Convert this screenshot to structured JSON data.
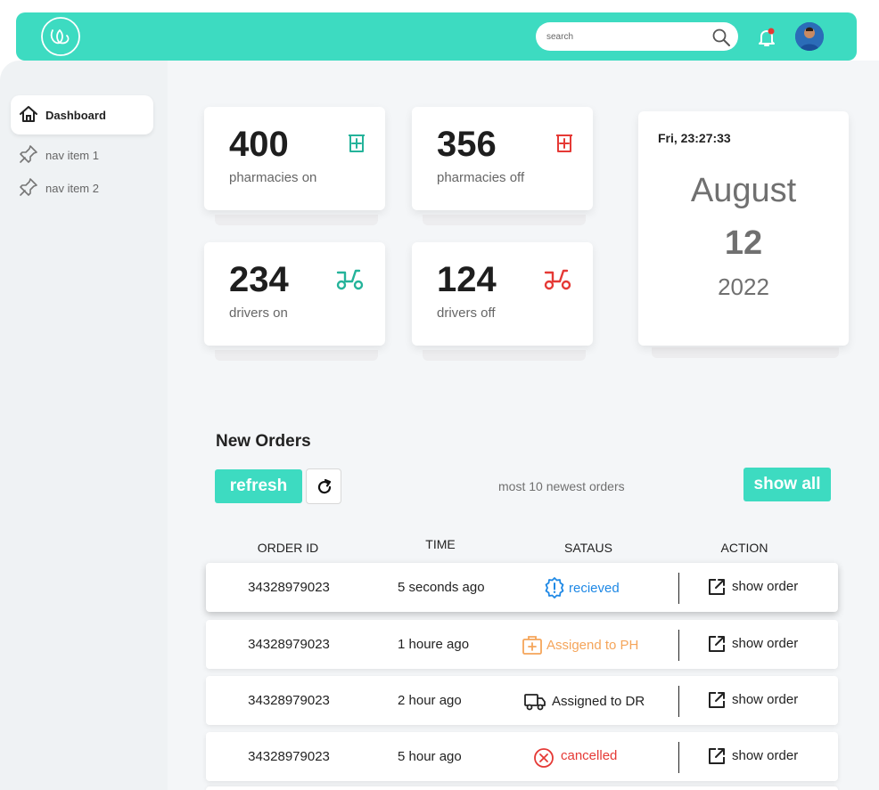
{
  "header": {
    "search_placeholder": "search",
    "icons": [
      "logo-icon",
      "search-icon",
      "bell-icon",
      "avatar"
    ],
    "colors": {
      "brand": "#3ddbc1",
      "alert_dot": "#e53935"
    }
  },
  "sidebar": {
    "items": [
      {
        "label": "Dashboard",
        "icon": "home-icon",
        "active": true
      },
      {
        "label": "nav item 1",
        "icon": "pin-icon",
        "active": false
      },
      {
        "label": "nav item 2",
        "icon": "pin-icon",
        "active": false
      }
    ]
  },
  "stats": [
    {
      "value": "400",
      "label": "pharmacies on",
      "icon": "pharmacy-icon",
      "color": "#24b39a"
    },
    {
      "value": "356",
      "label": "pharmacies  off",
      "icon": "pharmacy-icon",
      "color": "#e53935"
    },
    {
      "value": "234",
      "label": "drivers on",
      "icon": "scooter-icon",
      "color": "#24b39a"
    },
    {
      "value": "124",
      "label": "drivers off",
      "icon": "scooter-icon",
      "color": "#e53935"
    }
  ],
  "date_card": {
    "clock": "Fri, 23:27:33",
    "month": "August",
    "day": "12",
    "year": "2022"
  },
  "orders": {
    "title": "New Orders",
    "refresh_label": "refresh",
    "caption": "most 10 newest orders",
    "show_all_label": "show all",
    "columns": [
      "ORDER ID",
      "TIME",
      "SATAUS",
      "ACTION"
    ],
    "rows": [
      {
        "id": "34328979023",
        "time": "5 seconds ago",
        "status": "recieved",
        "status_icon": "alert-badge-icon",
        "status_color": "#1e88e5",
        "action": "show order"
      },
      {
        "id": "34328979023",
        "time": "1 houre ago",
        "status": "Assigend to PH",
        "status_icon": "medical-kit-icon",
        "status_color": "#f5a55a",
        "action": "show order"
      },
      {
        "id": "34328979023",
        "time": "2 hour ago",
        "status": "Assigned to DR",
        "status_icon": "truck-icon",
        "status_color": "#222222",
        "action": "show order"
      },
      {
        "id": "34328979023",
        "time": "5 hour ago",
        "status": "cancelled",
        "status_icon": "cancel-circle-icon",
        "status_color": "#e53935",
        "action": "show order"
      }
    ]
  }
}
